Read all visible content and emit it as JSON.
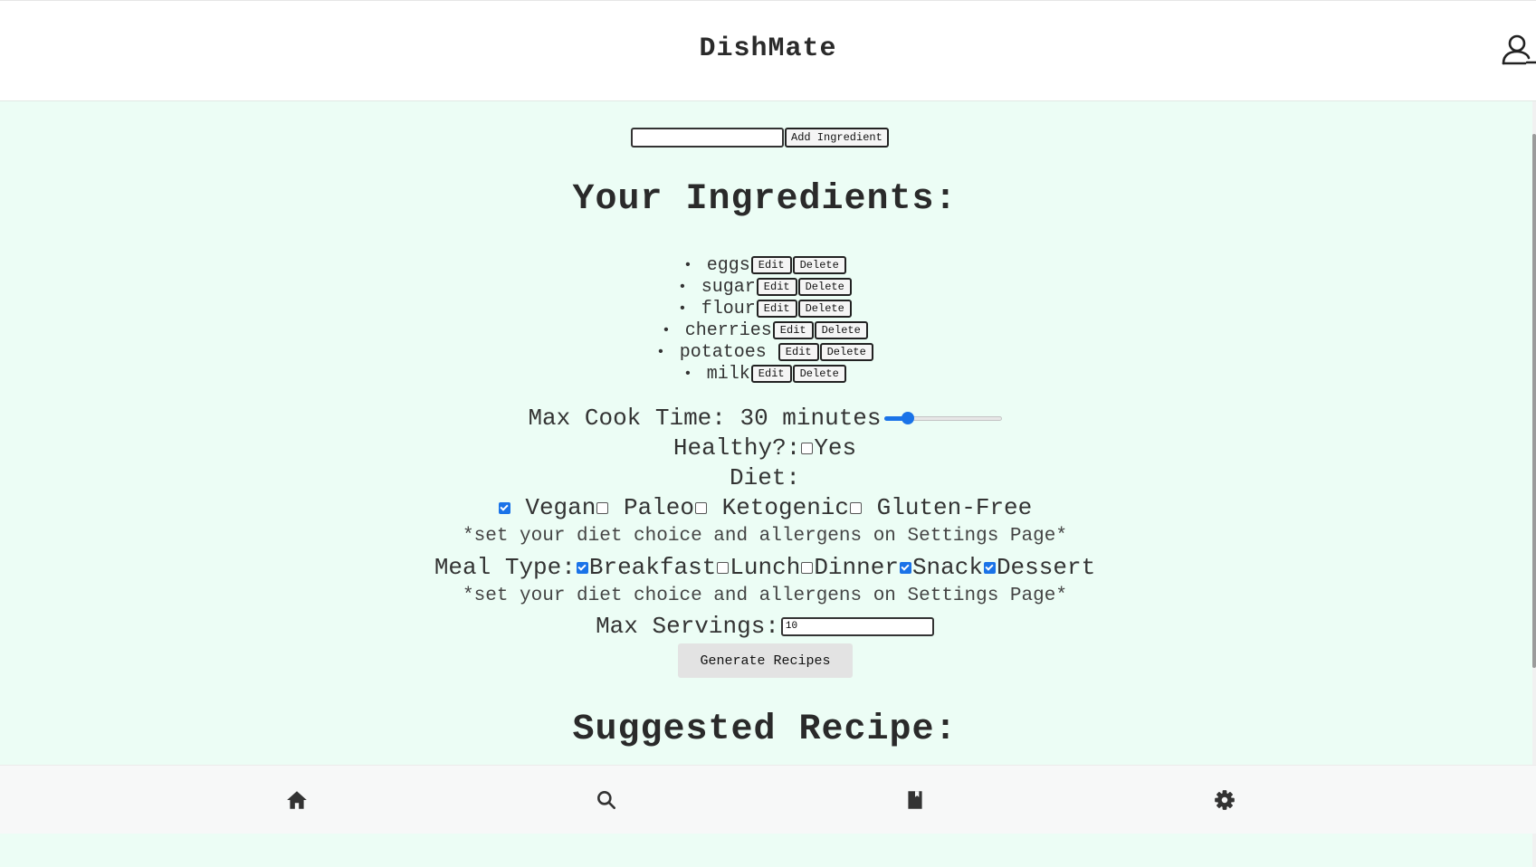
{
  "header": {
    "title": "DishMate",
    "profile_icon": "user-icon"
  },
  "ingredient_form": {
    "input_value": "",
    "add_label": "Add Ingredient"
  },
  "ingredients_heading": "Your Ingredients:",
  "ingredients": [
    {
      "name": "eggs",
      "edit_label": "Edit",
      "delete_label": "Delete"
    },
    {
      "name": "sugar",
      "edit_label": "Edit",
      "delete_label": "Delete"
    },
    {
      "name": "flour",
      "edit_label": "Edit",
      "delete_label": "Delete"
    },
    {
      "name": "cherries",
      "edit_label": "Edit",
      "delete_label": "Delete"
    },
    {
      "name": "potatoes ",
      "edit_label": "Edit",
      "delete_label": "Delete"
    },
    {
      "name": "milk",
      "edit_label": "Edit",
      "delete_label": "Delete"
    }
  ],
  "filters": {
    "cook_time": {
      "label": "Max Cook Time: 30 minutes",
      "value": 30,
      "min": 0,
      "max": 180,
      "accent": "#1a73e8"
    },
    "healthy": {
      "label": "Healthy?:",
      "option": "Yes",
      "checked": false
    },
    "diet": {
      "label": "Diet:",
      "options": [
        {
          "label": " Vegan",
          "checked": true
        },
        {
          "label": " Paleo",
          "checked": false
        },
        {
          "label": " Ketogenic",
          "checked": false
        },
        {
          "label": " Gluten-Free",
          "checked": false
        }
      ]
    },
    "diet_note": "*set your diet choice and allergens on Settings Page*",
    "meal_type": {
      "label": "Meal Type:",
      "options": [
        {
          "label": "Breakfast",
          "checked": true
        },
        {
          "label": "Lunch",
          "checked": false
        },
        {
          "label": "Dinner",
          "checked": false
        },
        {
          "label": "Snack",
          "checked": true
        },
        {
          "label": "Dessert",
          "checked": true
        }
      ]
    },
    "meal_note": "*set your diet choice and allergens on Settings Page*",
    "servings": {
      "label": "Max Servings:",
      "value": "10"
    }
  },
  "generate_label": "Generate Recipes",
  "suggested_heading": "Suggested Recipe:",
  "bottom_nav": [
    {
      "icon": "home-icon"
    },
    {
      "icon": "search-icon"
    },
    {
      "icon": "book-icon"
    },
    {
      "icon": "gear-icon"
    }
  ]
}
